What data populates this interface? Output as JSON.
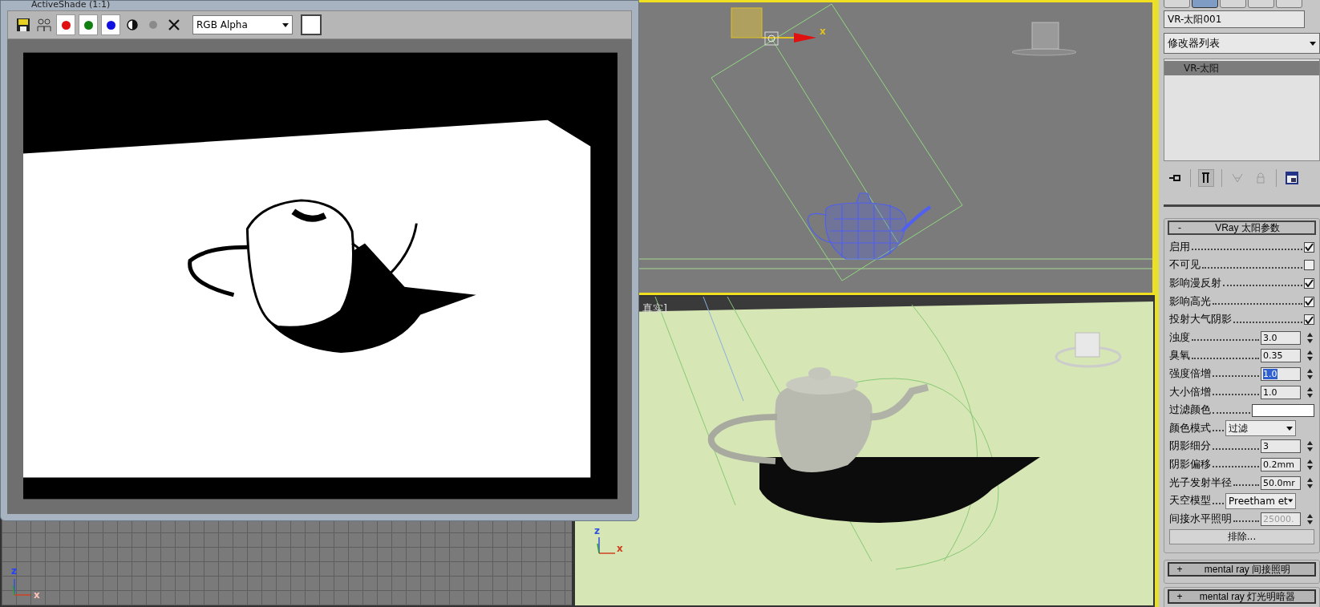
{
  "activeshade": {
    "title": "ActiveShade (1:1)",
    "channels": [
      {
        "color": "#e01010",
        "on": true
      },
      {
        "color": "#108010",
        "on": true
      },
      {
        "color": "#1010e0",
        "on": true
      }
    ],
    "channel_select": "RGB Alpha"
  },
  "viewports": [
    {
      "kind": "grid",
      "axes": [
        "z",
        "x"
      ],
      "active": false
    },
    {
      "kind": "wire",
      "axes": [
        "x"
      ],
      "active": true
    },
    {
      "kind": "shaded",
      "label": "真实]",
      "axes": [
        "z",
        "x"
      ],
      "active": false
    }
  ],
  "command_panel": {
    "tabs": [
      {
        "selected": false
      },
      {
        "selected": true
      },
      {
        "selected": false
      },
      {
        "selected": false
      },
      {
        "selected": false
      }
    ],
    "object_name": "VR-太阳001",
    "modifier_list": "修改器列表",
    "stack": [
      {
        "label": "VR-太阳",
        "selected": true
      }
    ],
    "rollouts": [
      {
        "sign": "-",
        "title": "VRay 太阳参数",
        "expanded": true,
        "params": [
          {
            "kind": "check",
            "label": "启用",
            "checked": true
          },
          {
            "kind": "check",
            "label": "不可见",
            "checked": false
          },
          {
            "kind": "check",
            "label": "影响漫反射",
            "checked": true
          },
          {
            "kind": "check",
            "label": "影响高光",
            "checked": true
          },
          {
            "kind": "check",
            "label": "投射大气阴影",
            "checked": true
          },
          {
            "kind": "spinner",
            "label": "浊度",
            "value": "3.0",
            "focused": false,
            "disabled": false
          },
          {
            "kind": "spinner",
            "label": "臭氧",
            "value": "0.35",
            "focused": false,
            "disabled": false
          },
          {
            "kind": "spinner",
            "label": "强度倍增",
            "value": "1.0",
            "focused": true,
            "disabled": false
          },
          {
            "kind": "spinner",
            "label": "大小倍增",
            "value": "1.0",
            "focused": false,
            "disabled": false
          },
          {
            "kind": "swatch",
            "label": "过滤颜色"
          },
          {
            "kind": "dropdown",
            "label": "颜色模式",
            "value": "过滤"
          },
          {
            "kind": "spinner",
            "label": "阴影细分",
            "value": "3",
            "focused": false,
            "disabled": false
          },
          {
            "kind": "spinner",
            "label": "阴影偏移",
            "value": "0.2mm",
            "focused": false,
            "disabled": false
          },
          {
            "kind": "spinner",
            "label": "光子发射半径",
            "value": "50.0mr",
            "focused": false,
            "disabled": false
          },
          {
            "kind": "dropdown",
            "label": "天空模型",
            "value": "Preetham et"
          },
          {
            "kind": "spinner",
            "label": "间接水平照明",
            "value": "25000.",
            "focused": false,
            "disabled": true
          },
          {
            "kind": "button",
            "label": "排除..."
          }
        ]
      },
      {
        "sign": "+",
        "title": "mental ray 间接照明",
        "expanded": false
      },
      {
        "sign": "+",
        "title": "mental ray 灯光明暗器",
        "expanded": false
      }
    ]
  }
}
